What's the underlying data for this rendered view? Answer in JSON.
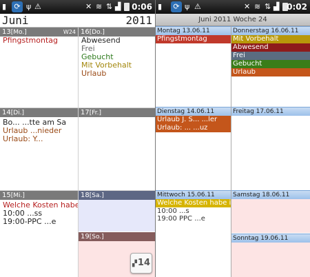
{
  "statusbar_left": {
    "time": "0:06",
    "app_icon": "calendar-app-icon"
  },
  "statusbar_right": {
    "time": "0:02",
    "app_icon": "calendar-app-icon"
  },
  "month_view": {
    "month": "Juni",
    "year": "2011",
    "days": [
      {
        "num": "13",
        "dow": "[Mo.]",
        "week": "W24",
        "events": [
          {
            "text": "Pfingstmontag",
            "color": "#b51e1e"
          }
        ]
      },
      {
        "num": "16",
        "dow": "[Do.]",
        "events": [
          {
            "text": "Abwesend",
            "color": "#222222"
          },
          {
            "text": "Frei",
            "color": "#666666"
          },
          {
            "text": "Gebucht",
            "color": "#2d7a1c"
          },
          {
            "text": "Mit Vorbehalt",
            "color": "#a2860b"
          },
          {
            "text": "Urlaub",
            "color": "#9a4a16"
          }
        ]
      },
      {
        "num": "14",
        "dow": "[Di.]",
        "events": [
          {
            "text": "Bo... ...tte am Sa",
            "color": "#222222"
          },
          {
            "text": "Urlaub ...nieder",
            "color": "#9a4a16"
          },
          {
            "text": "Urlaub: Y...",
            "color": "#9a4a16"
          }
        ]
      },
      {
        "num": "17",
        "dow": "[Fr.]",
        "events": []
      },
      {
        "num": "15",
        "dow": "[Mi.]",
        "events": [
          {
            "text": "Welche Kosten habe i",
            "color": "#b51e1e"
          },
          {
            "text": "10:00 ...ss",
            "color": "#222222"
          },
          {
            "text": "19:00-PPC ...e",
            "color": "#222222"
          }
        ]
      },
      {
        "num": "18",
        "dow": "[Sa.]",
        "events": []
      },
      {
        "num": "19",
        "dow": "[So.]",
        "events": []
      }
    ],
    "today_badge": "14"
  },
  "week_view": {
    "header": "Juni 2011 Woche 24",
    "days": {
      "mon": {
        "label": "Montag 13.06.11",
        "events": [
          {
            "text": "Pfingstmontag",
            "style": "bg-red"
          }
        ]
      },
      "thu": {
        "label": "Donnerstag 16.06.11",
        "events": [
          {
            "text": "Mit Vorbehalt",
            "style": "bg-olive"
          },
          {
            "text": "Abwesend",
            "style": "bg-darkred"
          },
          {
            "text": "Frei",
            "style": "bg-slate"
          },
          {
            "text": "Gebucht",
            "style": "bg-green"
          },
          {
            "text": "Urlaub",
            "style": "bg-orange"
          }
        ]
      },
      "tue": {
        "label": "Dienstag 14.06.11",
        "events": [
          {
            "text": "Urlaub J. S... ...ler",
            "style": "bg-orange"
          },
          {
            "text": "Urlaub: ... ...uz",
            "style": "bg-orange"
          }
        ]
      },
      "fri": {
        "label": "Freitag 17.06.11",
        "events": []
      },
      "wed": {
        "label": "Mittwoch 15.06.11",
        "highlight": "Welche Kosten habe ich",
        "lines": [
          "10:00 ...s",
          "19:00 PPC ...e"
        ]
      },
      "sat": {
        "label": "Samstag 18.06.11"
      },
      "sun": {
        "label": "Sonntag 19.06.11"
      }
    }
  }
}
